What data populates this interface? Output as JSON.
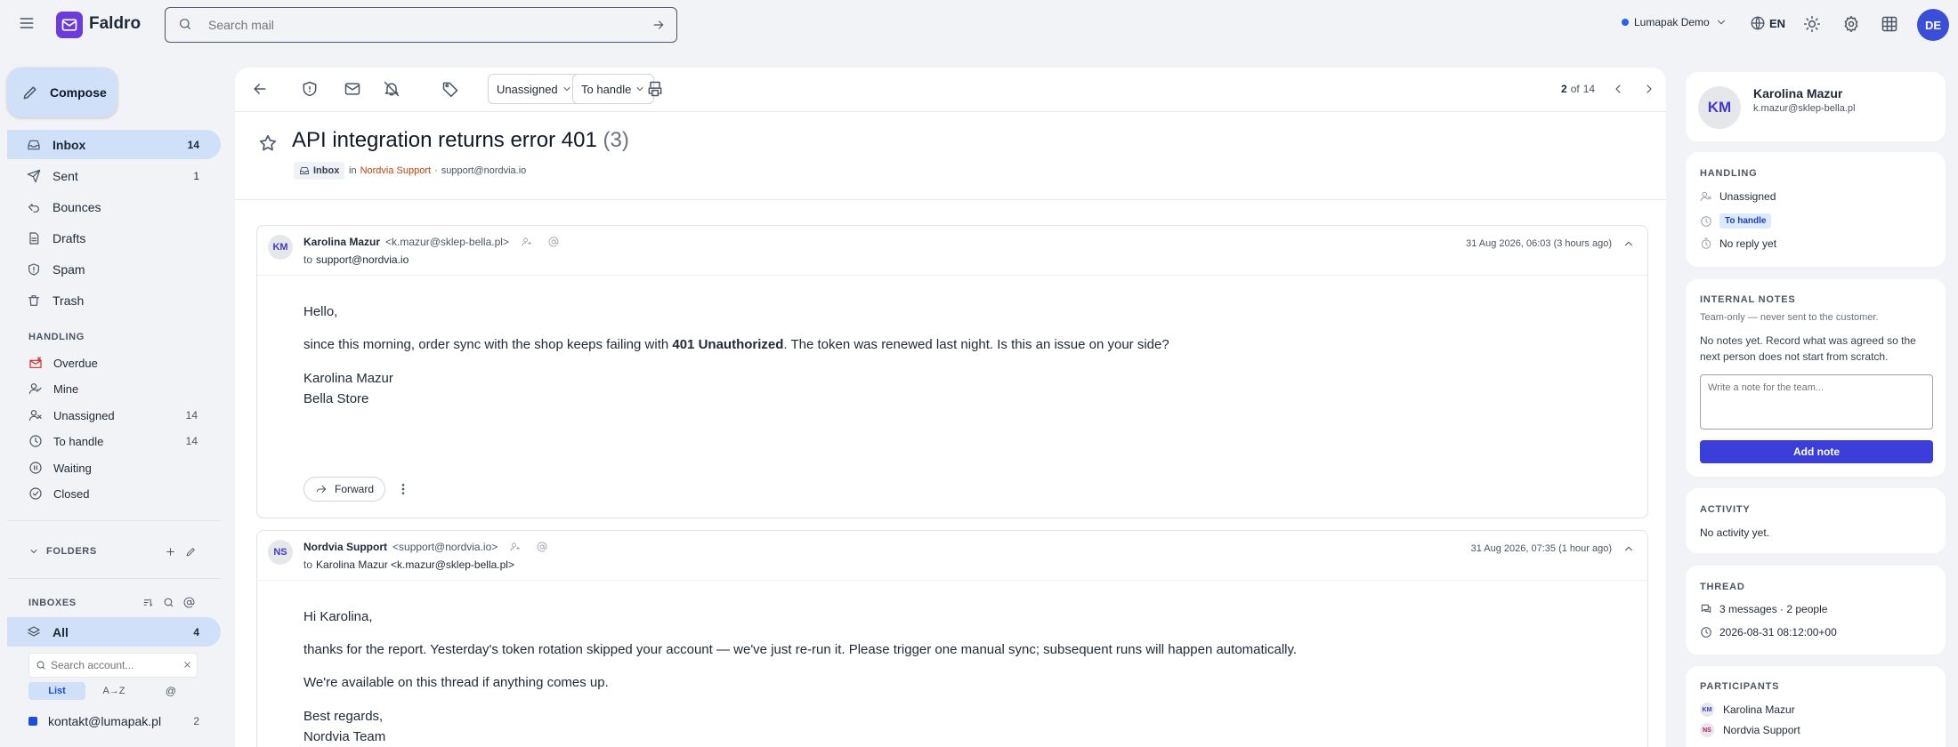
{
  "app": {
    "name": "Faldro",
    "search_placeholder": "Search mail",
    "workspace": "Lumapak Demo",
    "language": "EN",
    "user_initials": "DE"
  },
  "sidebar": {
    "compose_label": "Compose",
    "folders": [
      {
        "label": "Inbox",
        "count": "14",
        "icon": "inbox-icon"
      },
      {
        "label": "Sent",
        "count": "1",
        "icon": "send-icon"
      },
      {
        "label": "Bounces",
        "count": "",
        "icon": "bounce-icon"
      },
      {
        "label": "Drafts",
        "count": "",
        "icon": "draft-icon"
      },
      {
        "label": "Spam",
        "count": "",
        "icon": "spam-icon"
      },
      {
        "label": "Trash",
        "count": "",
        "icon": "trash-icon"
      }
    ],
    "handling_heading": "HANDLING",
    "handling": [
      {
        "label": "Overdue",
        "count": "",
        "icon": "overdue-icon"
      },
      {
        "label": "Mine",
        "count": "",
        "icon": "user-check-icon"
      },
      {
        "label": "Unassigned",
        "count": "14",
        "icon": "user-x-icon"
      },
      {
        "label": "To handle",
        "count": "14",
        "icon": "clock-icon"
      },
      {
        "label": "Waiting",
        "count": "",
        "icon": "pause-icon"
      },
      {
        "label": "Closed",
        "count": "",
        "icon": "check-circle-icon"
      }
    ],
    "folders_heading": "FOLDERS",
    "inboxes_heading": "INBOXES",
    "inbox_all_label": "All",
    "inbox_all_count": "4",
    "account_search_placeholder": "Search account...",
    "view_tabs": [
      "List",
      "A→Z",
      "@"
    ],
    "accounts": [
      {
        "label": "kontakt@lumapak.pl",
        "count": "2",
        "color": "#1d4ed8"
      }
    ]
  },
  "toolbar": {
    "assign_label": "Unassigned",
    "status_label": "To handle",
    "page_current": "2",
    "page_sep": "of",
    "page_total": "14"
  },
  "thread": {
    "subject": "API integration returns error 401",
    "count": "(3)",
    "label": "Inbox",
    "in_word": "in",
    "mailbox_name": "Nordvia Support",
    "mailbox_sep": "·",
    "mailbox_email": "support@nordvia.io"
  },
  "messages": [
    {
      "initials": "KM",
      "sender": "Karolina Mazur",
      "sender_email": "<k.mazur@sklep-bella.pl>",
      "to_word": "to",
      "recipient": "support@nordvia.io",
      "date": "31 Aug 2026, 06:03 (3 hours ago)",
      "greeting": "Hello,",
      "line_before": "since this morning, order sync with the shop keeps failing with ",
      "line_bold": "401 Unauthorized",
      "line_after": ". The token was renewed last night. Is this an issue on your side?",
      "signature_name": "Karolina Mazur",
      "signature_company": "Bella Store",
      "forward_label": "Forward"
    },
    {
      "initials": "NS",
      "sender": "Nordvia Support",
      "sender_email": "<support@nordvia.io>",
      "to_word": "to",
      "recipient": "Karolina Mazur <k.mazur@sklep-bella.pl>",
      "date": "31 Aug 2026, 07:35 (1 hour ago)",
      "greeting": "Hi Karolina,",
      "line1": "thanks for the report. Yesterday's token rotation skipped your account — we've just re-run it. Please trigger one manual sync; subsequent runs will happen automatically.",
      "line2": "We're available on this thread if anything comes up.",
      "closing": "Best regards,",
      "team": "Nordvia Team"
    }
  ],
  "contact": {
    "initials": "KM",
    "name": "Karolina Mazur",
    "email": "k.mazur@sklep-bella.pl"
  },
  "handling_card": {
    "heading": "HANDLING",
    "assignee": "Unassigned",
    "status": "To handle",
    "reply": "No reply yet"
  },
  "notes_card": {
    "heading": "INTERNAL NOTES",
    "subtitle": "Team-only — never sent to the customer.",
    "empty_text": "No notes yet. Record what was agreed so the next person does not start from scratch.",
    "placeholder": "Write a note for the team...",
    "add_label": "Add note"
  },
  "activity_card": {
    "heading": "ACTIVITY",
    "text": "No activity yet."
  },
  "thread_card": {
    "heading": "THREAD",
    "summary": "3 messages · 2 people",
    "timestamp": "2026-08-31 08:12:00+00"
  },
  "participants_card": {
    "heading": "PARTICIPANTS",
    "people": [
      {
        "initials": "KM",
        "name": "Karolina Mazur"
      },
      {
        "initials": "NS",
        "name": "Nordvia Support"
      }
    ]
  },
  "colors": {
    "accent": "#3b3ed8",
    "brand": "#6d3bdc",
    "selection": "#cfe0f8",
    "mailbox_link": "#c2410c",
    "status_chip": "#dbeafe"
  }
}
